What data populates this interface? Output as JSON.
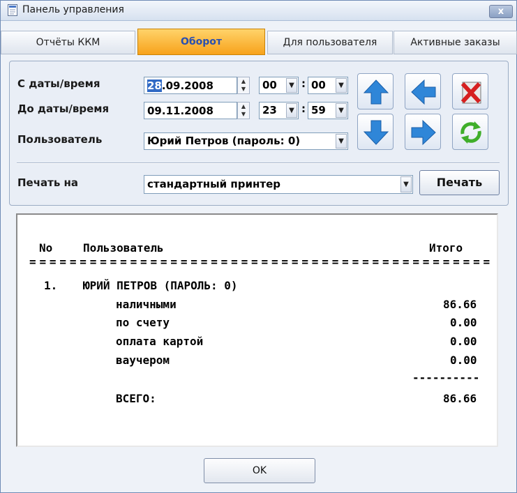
{
  "window": {
    "title": "Панель управления",
    "close_label": "x"
  },
  "tabs": [
    {
      "label": "Отчёты ККМ"
    },
    {
      "label": "Оборот"
    },
    {
      "label": "Для пользователя"
    },
    {
      "label": "Активные заказы"
    }
  ],
  "filters": {
    "from_label": "С даты/время",
    "from_date_day": "28",
    "from_date_rest": ".09.2008",
    "from_hour": "00",
    "from_minute": "00",
    "to_label": "До даты/время",
    "to_date": "09.11.2008",
    "to_hour": "23",
    "to_minute": "59",
    "user_label": "Пользователь",
    "user_value": "Юрий Петров (пароль: 0)",
    "print_label": "Печать на",
    "printer_value": "стандартный принтер",
    "print_button": "Печать",
    "time_separator": ":"
  },
  "report": {
    "header_no": "No",
    "header_user": "Пользователь",
    "header_total": "Итого",
    "separator": "==============================================",
    "row_number": "1.",
    "row_user": "ЮРИЙ ПЕТРОВ (ПАРОЛЬ: 0)",
    "lines": [
      {
        "label": "наличными",
        "value": "86.66"
      },
      {
        "label": "по счету",
        "value": "0.00"
      },
      {
        "label": "оплата картой",
        "value": "0.00"
      },
      {
        "label": "ваучером",
        "value": "0.00"
      }
    ],
    "dashes": "----------",
    "total_label": "ВСЕГО:",
    "total_value": "86.66"
  },
  "footer": {
    "ok_label": "OK"
  },
  "colors": {
    "active_tab": "#f7a21b",
    "active_tab_text": "#2a50b0",
    "nav_arrow": "#2f86d8",
    "refresh": "#3fae2a",
    "delete": "#d62020"
  }
}
